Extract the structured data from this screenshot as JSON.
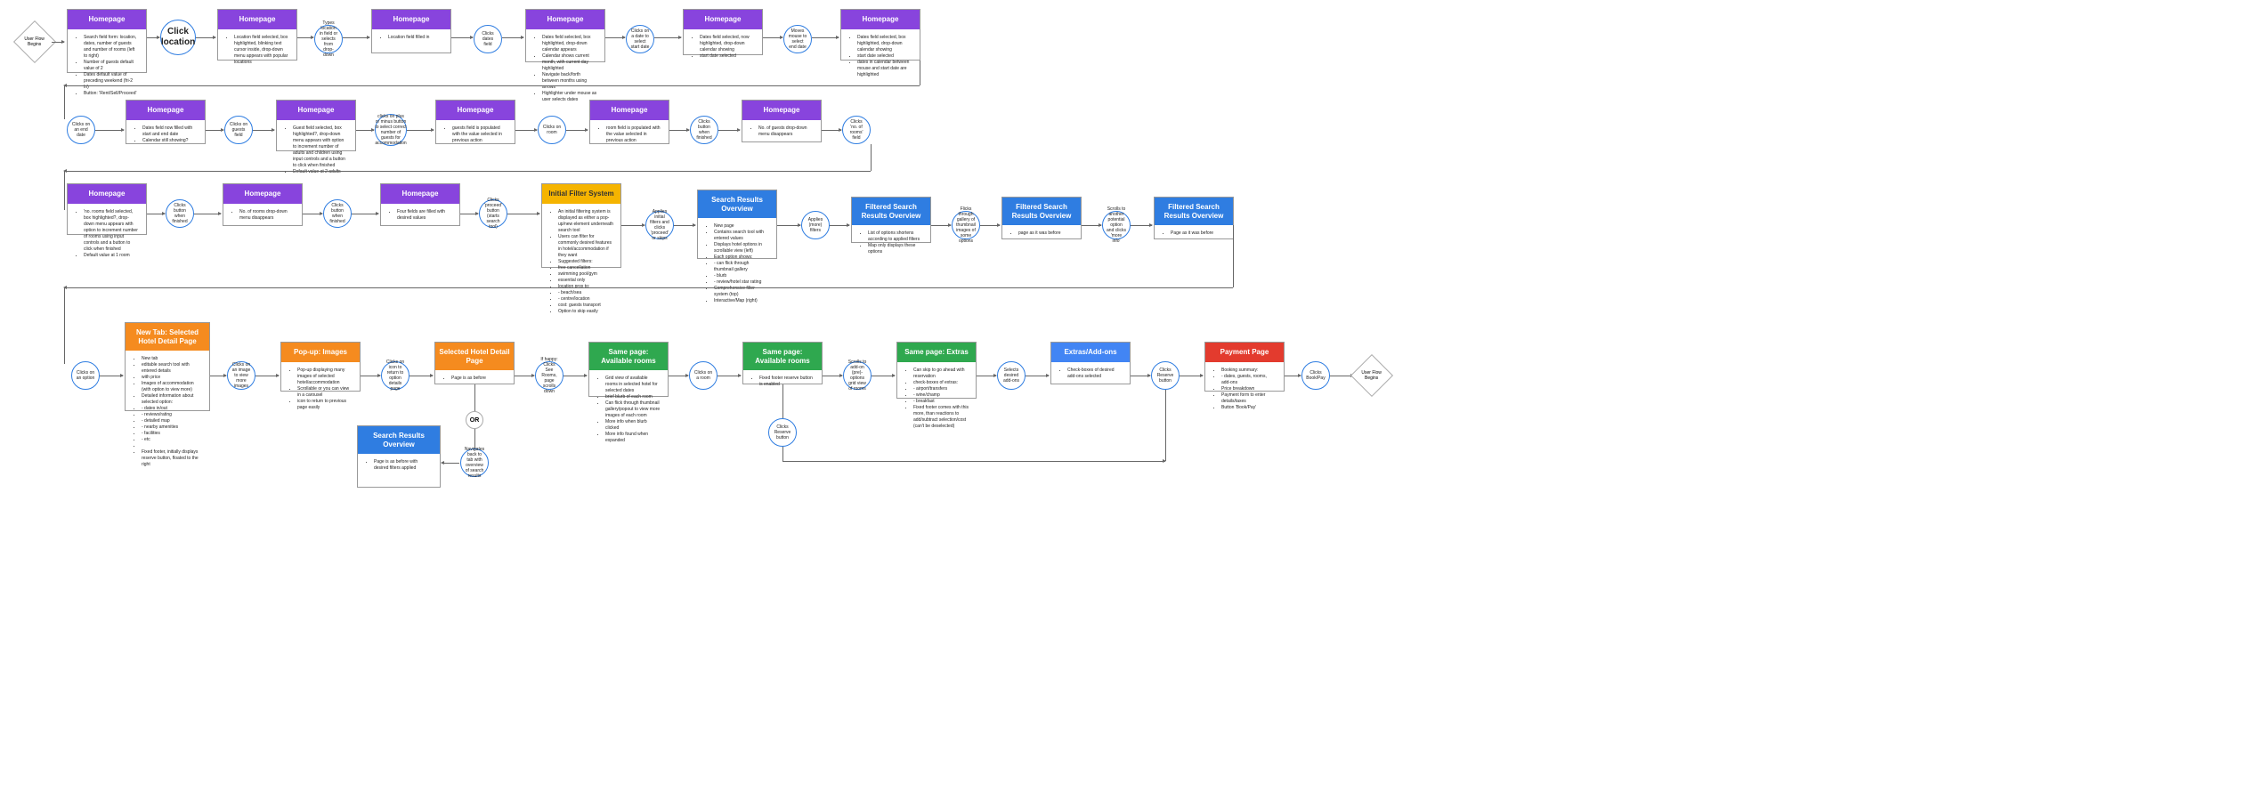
{
  "flow": {
    "start": "User Flow Begins",
    "end": "User Flow Begins",
    "click_location": "Click location",
    "or": "OR",
    "row1": {
      "c1": {
        "title": "Homepage",
        "items": [
          "Search field form: location, dates, number of guests and number of rooms (left to right)",
          "Number of guests default value of 2",
          "Dates default value of preceding weekend (fri-2 fri)",
          "Button: 'Rent/Sell/Proceed'"
        ]
      },
      "c2": {
        "title": "Homepage",
        "items": [
          "Location field selected, box highlighted, blinking text cursor inside, drop-down menu appears with popular locations"
        ]
      },
      "a3": "Types location in field or selects from drop-down",
      "c3": {
        "title": "Homepage",
        "items": [
          "Location field filled in"
        ]
      },
      "a4": "Clicks dates field",
      "c4": {
        "title": "Homepage",
        "items": [
          "Dates field selected, box highlighted, drop-down calendar appears",
          "Calendar shows current month, with current day highlighted",
          "Navigate back/forth between months using arrows",
          "Highlighter under mouse as user selects dates"
        ]
      },
      "a5": "Clicks on a date to select start date",
      "c5": {
        "title": "Homepage",
        "items": [
          "Dates field selected, now highlighted, drop-down calendar showing",
          "start date selected"
        ]
      },
      "a6": "Moves mouse to select end date",
      "c6": {
        "title": "Homepage",
        "items": [
          "Dates field selected, box highlighted, drop-down calendar showing",
          "start date selected",
          "dates in calendar between mouse and start date are highlighted"
        ]
      }
    },
    "row2": {
      "a1": "Clicks on an end date",
      "c1": {
        "title": "Homepage",
        "items": [
          "Dates field now filled with start and end date",
          "Calendar still showing?"
        ]
      },
      "a2": "Clicks on guests field",
      "c2": {
        "title": "Homepage",
        "items": [
          "Guest field selected, box highlighted?, drop-down menu appears with option to increment number of adults and children using input controls and a button to click when finished",
          "Default value at 2 adults"
        ]
      },
      "a3": "clicks on plus or minus button to select correct number of guests for accommodation",
      "c3": {
        "title": "Homepage",
        "items": [
          "guests field is populated with the value selected in previous action"
        ]
      },
      "a4": "Clicks on room",
      "c4": {
        "title": "Homepage",
        "items": [
          "room field is populated with the value selected in previous action"
        ]
      },
      "a5": "Clicks button when finished",
      "c5": {
        "title": "Homepage",
        "items": [
          "No. of guests drop-down menu disappears"
        ]
      },
      "a6": "Clicks 'no. of rooms' field"
    },
    "row3": {
      "c1": {
        "title": "Homepage",
        "items": [
          "'no. rooms field selected, box highlighted?, drop-down menu appears with option to increment number of rooms using input controls and a button to click when finished",
          "Default value at 1 room"
        ]
      },
      "a2": "Clicks button when finished",
      "c2": {
        "title": "Homepage",
        "items": [
          "No. of rooms drop-down menu disappears"
        ]
      },
      "a3": "Clicks button when finished",
      "c3": {
        "title": "Homepage",
        "items": [
          "Four fields are filled with desired values"
        ]
      },
      "a4": "Clicks 'proceed' button (starts search tool)",
      "c4": {
        "title": "Initial Filter System",
        "items": [
          "An initial filtering system is displayed as either a pop-up/new element underneath search tool",
          "Users can filter for commonly desired features in hotel/accommodation if they want",
          "Suggested filters:",
          "free cancellation",
          "swimming pool/gym",
          "essential only",
          "location prox to:",
          "- beach/sea",
          "- centre/location",
          "cost: guests transport",
          "Option to skip easily"
        ]
      },
      "a5": "Applies initial filters and clicks 'proceed' or skips",
      "c5": {
        "title": "Search Results Overview",
        "items": [
          "New page",
          "Contains search tool with entered values",
          "Displays hotel options in scrollable view (left)",
          "Each option shows:",
          "- can flick through thumbnail gallery",
          "- blurb",
          "- review/hotel star rating",
          "Comprehensive filter system (top)",
          "Interactive/Map (right)"
        ]
      },
      "a6": "Applies (more) filters",
      "c6": {
        "title": "Filtered Search Results Overview",
        "items": [
          "List of options shortens according to applied filters",
          "Map only displays these options"
        ]
      },
      "a7": "Flicks through gallery of thumbnail images of some options",
      "c7": {
        "title": "Filtered Search Results Overview",
        "items": [
          "page as it was before"
        ]
      },
      "a8": "Scrolls to another potential option and clicks 'more info'",
      "c8": {
        "title": "Filtered Search Results Overview",
        "items": [
          "Page as it was before"
        ]
      }
    },
    "row4": {
      "a1": "Clicks on an option",
      "c1": {
        "title": "New Tab: Selected Hotel Detail Page",
        "items": [
          "New tab",
          "editable search tool with entered details",
          "with price",
          "Images of accommodation (with option to view more)",
          "Detailed information about selected option:",
          "- dates in/out",
          "- reviews/rating",
          "- detailed map",
          "- nearby amenities",
          "- facilities",
          "- etc",
          "Fixed footer, initially displays reserve button, floated to the right"
        ]
      },
      "a2": "Clicks on an image to view more images",
      "c2": {
        "title": "Pop-up: Images",
        "items": [
          "Pop-up displaying many images of selected hotel/accommodation",
          "Scrollable or you can view in a carousel",
          "icon to return to previous page easily"
        ]
      },
      "a3": "Clicks on icon to return to option details page",
      "c3": {
        "title": "Selected Hotel Detail Page",
        "items": [
          "Page is as before"
        ]
      },
      "a4": "If happy: Clicks See Rooms, page scrolls down",
      "c4": {
        "title": "Same page: Available rooms",
        "items": [
          "Grid view of available rooms in selected hotel for selected dates",
          "brief blurb of each room",
          "Can flick through thumbnail gallery/popout to view more images of each room",
          "More info when blurb clicked",
          "More info found when expanded"
        ]
      },
      "a5": "Clicks on a room",
      "c5": {
        "title": "Same page: Available rooms",
        "items": [
          "Fixed footer reserve button is enabled"
        ]
      },
      "a5b": "Clicks Reserve button",
      "a6": "Scrolls to add-on (pre)-options grid view of rooms",
      "c6": {
        "title": "Same page: Extras",
        "items": [
          "Can skip to go ahead with reservation",
          "check-boxes of extras:",
          "- airport/transfers",
          "- wine/champ",
          "- breakfast",
          "Fixed footer comes with this more, than reactions to add/subtract selection/cost (can't be deselected)"
        ]
      },
      "a7": "Selects desired add-ons",
      "c7": {
        "title": "Extras/Add-ons",
        "items": [
          "Check-boxes of desired add-ons selected"
        ]
      },
      "a8": "Clicks Reserve button",
      "c8": {
        "title": "Payment Page",
        "items": [
          "Booking summary:",
          "- dates, guests, rooms, add-ons",
          "Price breakdown",
          "Payment form to enter details/taxes",
          "Button 'Book/Pay'"
        ]
      },
      "a9": "Clicks Book/Pay"
    },
    "row5": {
      "c1": {
        "title": "Search Results Overview",
        "items": [
          "Page is as before with desired filters applied"
        ]
      },
      "a1": "Navigates back to tab with overview of search results"
    }
  }
}
